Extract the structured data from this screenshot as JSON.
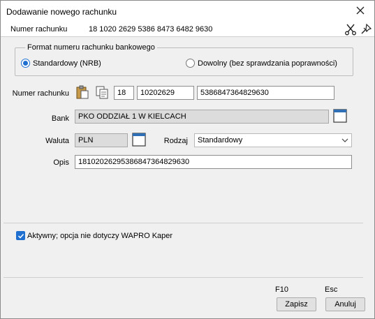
{
  "window": {
    "title": "Dodawanie nowego rachunku",
    "close_icon": "close-icon"
  },
  "header": {
    "label": "Numer rachunku",
    "value": "18 1020 2629 5386 8473 6482 9630",
    "icons": [
      "scissors-icon",
      "pin-icon"
    ]
  },
  "format_group": {
    "title": "Format numeru rachunku bankowego",
    "options": [
      {
        "label": "Standardowy (NRB)",
        "selected": true
      },
      {
        "label": "Dowolny (bez sprawdzania poprawności)",
        "selected": false
      }
    ]
  },
  "account": {
    "label": "Numer rachunku",
    "check_digits": "18",
    "bank_code": "10202629",
    "account_part": "5386847364829630"
  },
  "bank": {
    "label": "Bank",
    "value": "PKO ODDZIAŁ 1 W KIELCACH"
  },
  "currency": {
    "label": "Waluta",
    "value": "PLN"
  },
  "type": {
    "label": "Rodzaj",
    "value": "Standardowy"
  },
  "description": {
    "label": "Opis",
    "value": "18102026295386847364829630"
  },
  "active": {
    "label": "Aktywny; opcja nie dotyczy WAPRO Kaper",
    "checked": true
  },
  "footer": {
    "save": {
      "hotkey": "F10",
      "label": "Zapisz"
    },
    "cancel": {
      "hotkey": "Esc",
      "label": "Anuluj"
    }
  },
  "colors": {
    "accent": "#1f6fd1",
    "readonly_bg": "#dcdcdc",
    "dialog_bg": "#f0f0f0"
  }
}
